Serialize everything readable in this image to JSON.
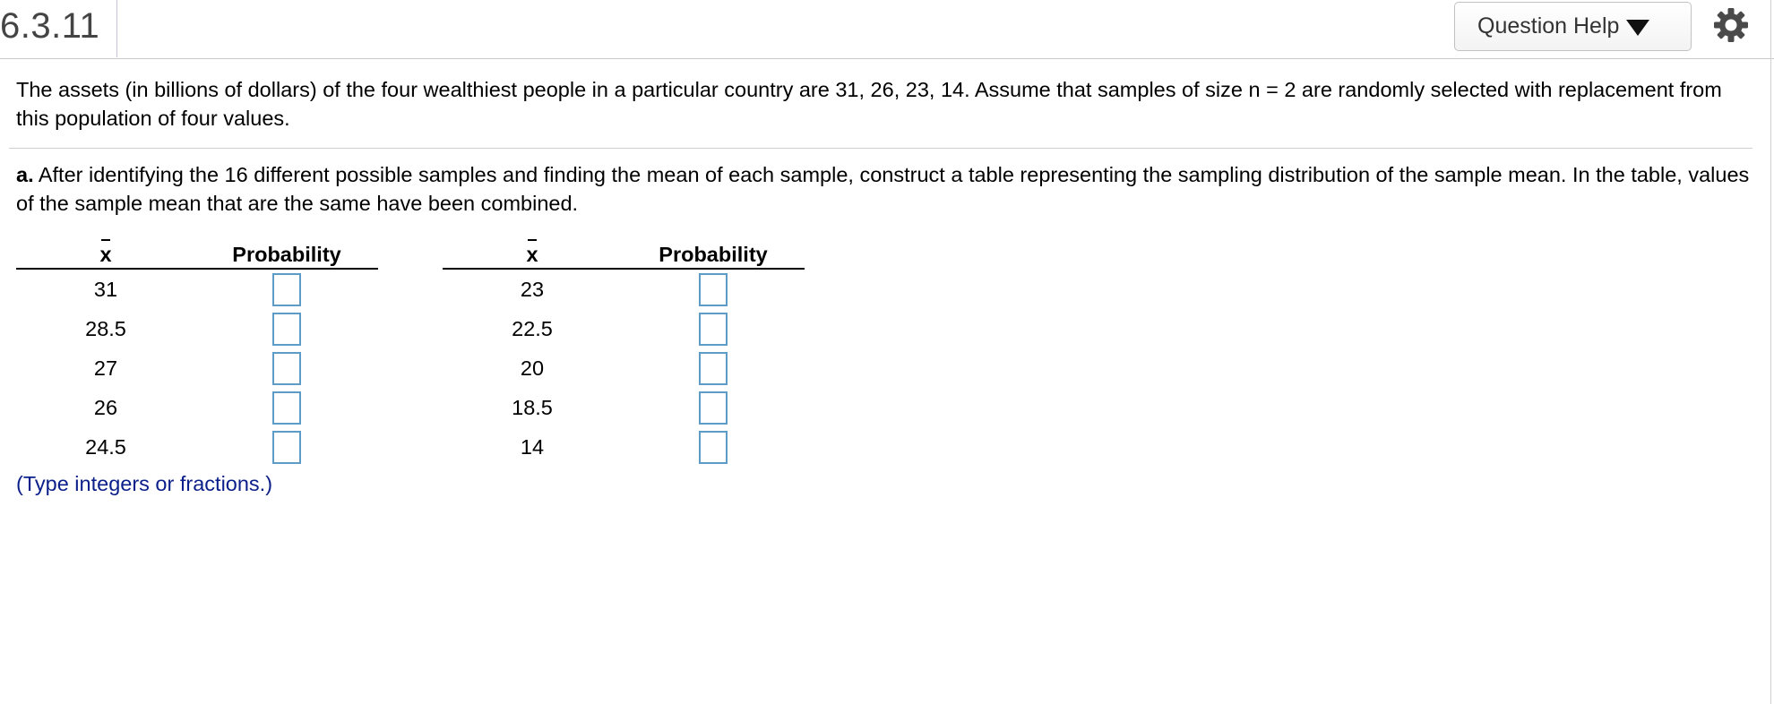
{
  "header": {
    "question_number": "6.3.11",
    "help_label": "Question Help",
    "help_icon": "caret-down-icon",
    "settings_icon": "gear-icon"
  },
  "problem": {
    "text": "The assets (in billions of dollars) of the four wealthiest people in a particular country are 31, 26, 23, 14. Assume that samples of size n = 2 are randomly selected with replacement from this population of four values."
  },
  "part_a": {
    "label": "a.",
    "text": " After identifying the 16 different possible samples and finding the mean of each sample, construct a table representing the sampling distribution of the sample mean. In the table, values of the sample mean that are the same have been combined."
  },
  "table": {
    "xbar_header": "x",
    "prob_header": "Probability",
    "left_values": [
      "31",
      "28.5",
      "27",
      "26",
      "24.5"
    ],
    "right_values": [
      "23",
      "22.5",
      "20",
      "18.5",
      "14"
    ]
  },
  "hint": "(Type integers or fractions.)"
}
